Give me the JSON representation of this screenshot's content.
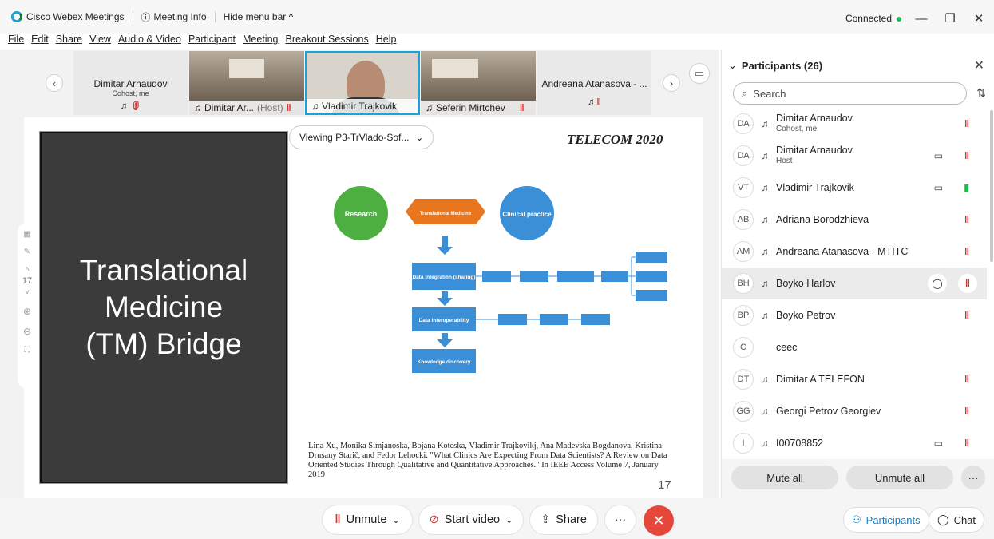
{
  "titlebar": {
    "app": "Cisco Webex Meetings",
    "meeting_info": "Meeting Info",
    "hide_menu": "Hide menu bar ^",
    "status": "Connected"
  },
  "menu": [
    "File",
    "Edit",
    "Share",
    "View",
    "Audio & Video",
    "Participant",
    "Meeting",
    "Breakout Sessions",
    "Help"
  ],
  "strip": {
    "card1": {
      "name": "Dimitar Arnaudov",
      "role": "Cohost, me"
    },
    "tile1": {
      "name": "Dimitar Ar...",
      "host": "(Host)"
    },
    "tile2": {
      "name": "Vladimir Trajkovik"
    },
    "tile3": {
      "name": "Seferin Mirtchev"
    },
    "card2": {
      "name": "Andreana Atanasova - ..."
    }
  },
  "slide": {
    "viewing": "Viewing P3-TrVlado-Sof...",
    "title_lines": [
      "Translational",
      "Medicine",
      "(TM) Bridge"
    ],
    "conference": "TELECOM 2020",
    "citation": "Lina Xu, Monika Simjanoska, Bojana Koteska, Vladimir Trajkovikj, Ana Madevska Bogdanova, Kristina Drusany Starič, and Fedor Lehocki. \"What Clinics Are Expecting From Data Scientists? A Review on Data Oriented Studies Through Qualitative and Quantitative Approaches.\" In IEEE Access Volume 7, January 2019",
    "number": "17",
    "side_page": "17",
    "diagram": {
      "research": "Research",
      "translational": "Translational Medicine",
      "clinical": "Clinical practice",
      "integration": "Data integration (sharing)",
      "interop": "Data interoperability",
      "discovery": "Knowledge discovery"
    }
  },
  "participants": {
    "header": "Participants (26)",
    "search_placeholder": "Search",
    "list": [
      {
        "initials": "DA",
        "name": "Dimitar Arnaudov",
        "sub": "Cohost, me",
        "cam": false,
        "mic": "muted"
      },
      {
        "initials": "DA",
        "name": "Dimitar Arnaudov",
        "sub": "Host",
        "cam": true,
        "mic": "muted"
      },
      {
        "initials": "VT",
        "name": "Vladimir Trajkovik",
        "sub": "",
        "cam": true,
        "mic": "active"
      },
      {
        "initials": "AB",
        "name": "Adriana Borodzhieva",
        "sub": "",
        "cam": false,
        "mic": "muted"
      },
      {
        "initials": "AM",
        "name": "Andreana Atanasova - MTITC",
        "sub": "",
        "cam": false,
        "mic": "muted"
      },
      {
        "initials": "BH",
        "name": "Boyko Harlov",
        "sub": "",
        "cam": false,
        "mic": "muted"
      },
      {
        "initials": "BP",
        "name": "Boyko Petrov",
        "sub": "",
        "cam": false,
        "mic": "muted"
      },
      {
        "initials": "C",
        "name": "ceec",
        "sub": "",
        "cam": false,
        "mic": "none"
      },
      {
        "initials": "DT",
        "name": "Dimitar A TELEFON",
        "sub": "",
        "cam": false,
        "mic": "muted"
      },
      {
        "initials": "GG",
        "name": "Georgi Petrov Georgiev",
        "sub": "",
        "cam": false,
        "mic": "muted"
      },
      {
        "initials": "I",
        "name": "I00708852",
        "sub": "",
        "cam": true,
        "mic": "muted"
      }
    ],
    "mute_all": "Mute all",
    "unmute_all": "Unmute all"
  },
  "controls": {
    "unmute": "Unmute",
    "start_video": "Start video",
    "share": "Share",
    "participants": "Participants",
    "chat": "Chat"
  },
  "colors": {
    "end": "#e5483b",
    "accent": "#1aa3d9",
    "green": "#4caf3f",
    "blue": "#3a8fd6",
    "orange": "#e8761e"
  }
}
